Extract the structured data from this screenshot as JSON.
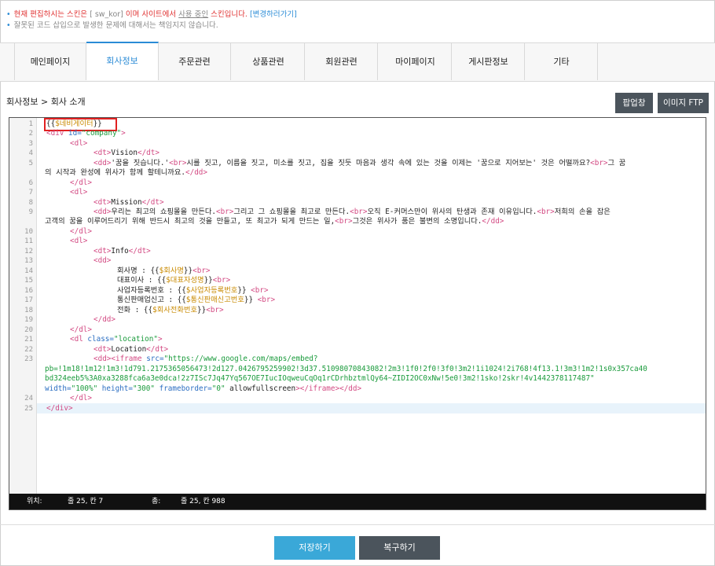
{
  "notice": {
    "line1_red1": "현재 편집하시는 스킨은",
    "line1_skin": "[ sw_kor]",
    "line1_red2": "이며 사이트에서",
    "line1_inuse": "사용 중인",
    "line1_red3": "스킨입니다.",
    "line1_link": "[변경하러가기]",
    "line2": "잘못된 코드 삽입으로 발생한 문제에 대해서는 책임지지 않습니다."
  },
  "tabs": [
    "메인페이지",
    "회사정보",
    "주문관련",
    "상품관련",
    "회원관련",
    "마이페이지",
    "게시판정보",
    "기타"
  ],
  "active_tab": "회사정보",
  "breadcrumb": "회사정보 > 회사 소개",
  "buttons": {
    "popup": "팝업창",
    "image_ftp": "이미지 FTP",
    "save": "저장하기",
    "restore": "복구하기"
  },
  "editor": {
    "line_numbers": [
      "1",
      "2",
      "3",
      "4",
      "5",
      "",
      "6",
      "7",
      "8",
      "9",
      "",
      "10",
      "11",
      "12",
      "13",
      "14",
      "15",
      "16",
      "17",
      "18",
      "19",
      "20",
      "21",
      "22",
      "23",
      "",
      "",
      "",
      "24",
      "25"
    ],
    "status": {
      "pos_label": "위치:",
      "pos_value": "줄 25, 칸 7",
      "total_label": "총:",
      "total_value": "줄 25, 칸 988"
    }
  }
}
